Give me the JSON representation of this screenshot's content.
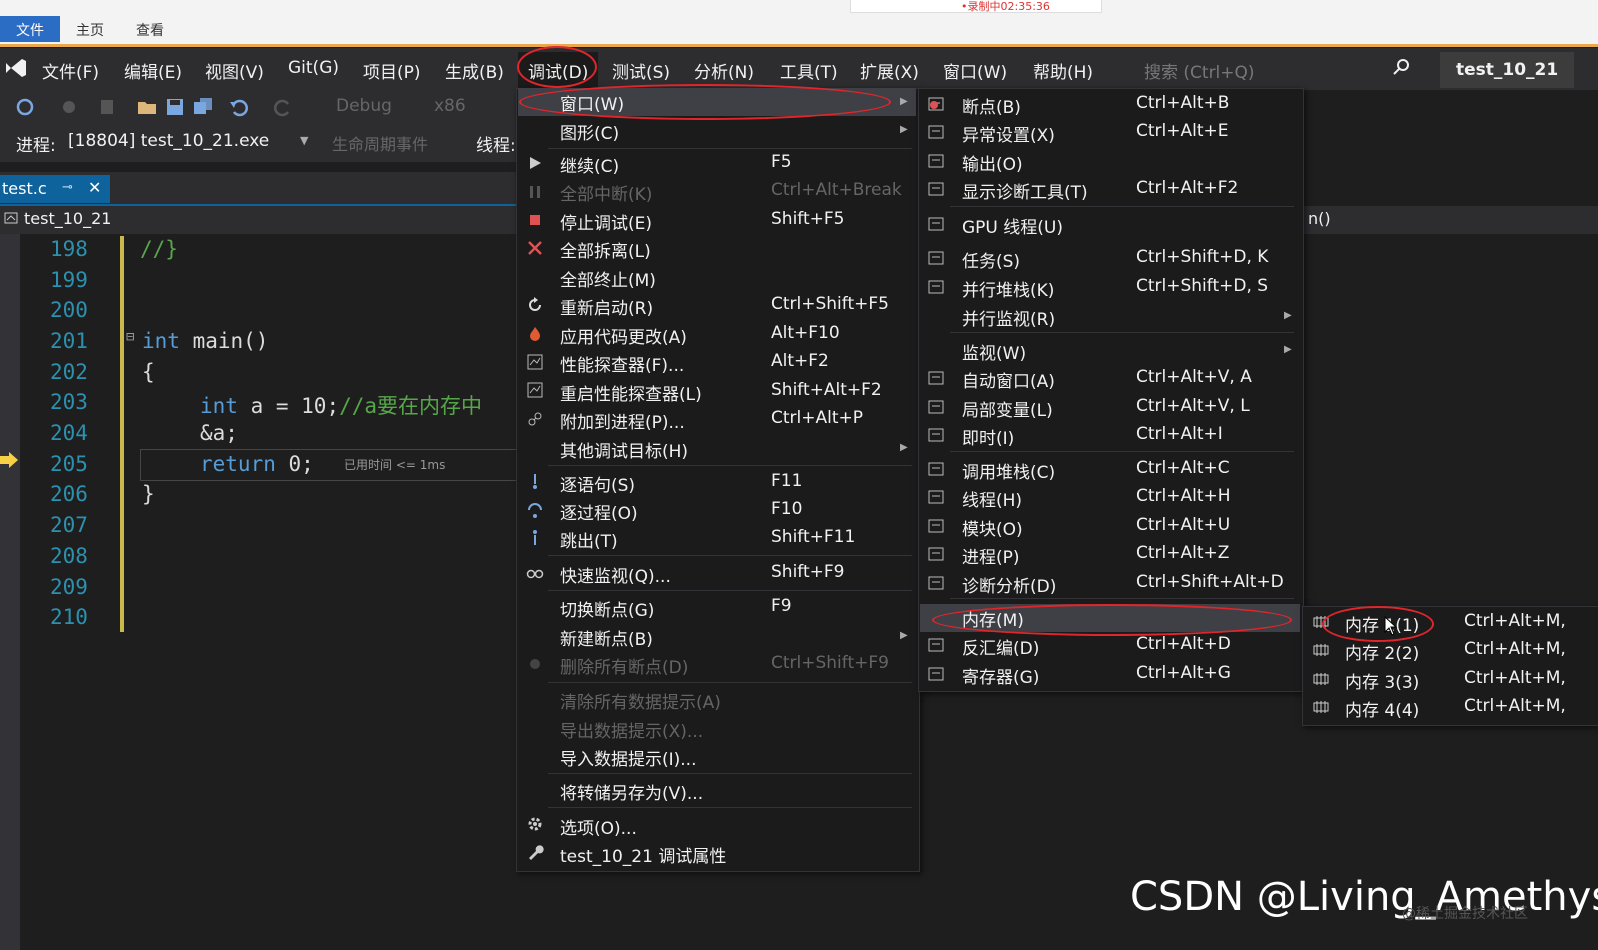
{
  "recorder": {
    "tabs": [
      "文件",
      "主页",
      "查看"
    ],
    "status": "•录制中02:35:36"
  },
  "menubar": {
    "items": [
      "文件(F)",
      "编辑(E)",
      "视图(V)",
      "Git(G)",
      "项目(P)",
      "生成(B)",
      "调试(D)",
      "测试(S)",
      "分析(N)",
      "工具(T)",
      "扩展(X)",
      "窗口(W)",
      "帮助(H)"
    ],
    "search_placeholder": "搜索 (Ctrl+Q)",
    "solution": "test_10_21"
  },
  "toolbar": {
    "config": "Debug",
    "platform": "x86"
  },
  "process": {
    "label": "进程:",
    "value": "[18804] test_10_21.exe",
    "lifecycle": "生命周期事件",
    "thread_label": "线程:"
  },
  "tab": {
    "name": "test.c",
    "pin": "⊸",
    "close": "✕"
  },
  "navbar": {
    "project": "test_10_21",
    "right": "n()"
  },
  "editor": {
    "lines": [
      "198",
      "199",
      "200",
      "201",
      "202",
      "203",
      "204",
      "205",
      "206",
      "207",
      "208",
      "209",
      "210"
    ],
    "code": {
      "l198": "//}",
      "l201_kw": "int",
      "l201_rest": " main()",
      "l202": "{",
      "l203_kw": "int",
      "l203_rest": " a = 10;",
      "l203_cm": "//a要在内存中",
      "l204": "&a;",
      "l205_kw": "return",
      "l205_rest": " 0;",
      "l206": "}"
    },
    "elapsed": "已用时间 <= 1ms"
  },
  "debug_menu": {
    "window": "窗口(W)",
    "graphics": "图形(C)",
    "continue": {
      "label": "继续(C)",
      "shortcut": "F5"
    },
    "break_all": {
      "label": "全部中断(K)",
      "shortcut": "Ctrl+Alt+Break"
    },
    "stop": {
      "label": "停止调试(E)",
      "shortcut": "Shift+F5"
    },
    "detach_all": {
      "label": "全部拆离(L)"
    },
    "terminate_all": {
      "label": "全部终止(M)"
    },
    "restart": {
      "label": "重新启动(R)",
      "shortcut": "Ctrl+Shift+F5"
    },
    "apply_code": {
      "label": "应用代码更改(A)",
      "shortcut": "Alt+F10"
    },
    "profiler": {
      "label": "性能探查器(F)...",
      "shortcut": "Alt+F2"
    },
    "relaunch_profiler": {
      "label": "重启性能探查器(L)",
      "shortcut": "Shift+Alt+F2"
    },
    "attach": {
      "label": "附加到进程(P)...",
      "shortcut": "Ctrl+Alt+P"
    },
    "other_targets": {
      "label": "其他调试目标(H)"
    },
    "step_into": {
      "label": "逐语句(S)",
      "shortcut": "F11"
    },
    "step_over": {
      "label": "逐过程(O)",
      "shortcut": "F10"
    },
    "step_out": {
      "label": "跳出(T)",
      "shortcut": "Shift+F11"
    },
    "quick_watch": {
      "label": "快速监视(Q)...",
      "shortcut": "Shift+F9"
    },
    "toggle_bp": {
      "label": "切换断点(G)",
      "shortcut": "F9"
    },
    "new_bp": {
      "label": "新建断点(B)"
    },
    "delete_bps": {
      "label": "删除所有断点(D)",
      "shortcut": "Ctrl+Shift+F9"
    },
    "clear_tips": {
      "label": "清除所有数据提示(A)"
    },
    "export_tips": {
      "label": "导出数据提示(X)..."
    },
    "import_tips": {
      "label": "导入数据提示(I)..."
    },
    "save_dump": {
      "label": "将转储另存为(V)..."
    },
    "options": {
      "label": "选项(O)..."
    },
    "props": {
      "label": "test_10_21 调试属性"
    }
  },
  "window_menu": {
    "items": [
      {
        "label": "断点(B)",
        "shortcut": "Ctrl+Alt+B"
      },
      {
        "label": "异常设置(X)",
        "shortcut": "Ctrl+Alt+E"
      },
      {
        "label": "输出(O)",
        "shortcut": ""
      },
      {
        "label": "显示诊断工具(T)",
        "shortcut": "Ctrl+Alt+F2"
      },
      {
        "label": "GPU 线程(U)",
        "shortcut": ""
      },
      {
        "label": "任务(S)",
        "shortcut": "Ctrl+Shift+D, K"
      },
      {
        "label": "并行堆栈(K)",
        "shortcut": "Ctrl+Shift+D, S"
      },
      {
        "label": "并行监视(R)",
        "shortcut": ""
      },
      {
        "label": "监视(W)",
        "shortcut": ""
      },
      {
        "label": "自动窗口(A)",
        "shortcut": "Ctrl+Alt+V, A"
      },
      {
        "label": "局部变量(L)",
        "shortcut": "Ctrl+Alt+V, L"
      },
      {
        "label": "即时(I)",
        "shortcut": "Ctrl+Alt+I"
      },
      {
        "label": "调用堆栈(C)",
        "shortcut": "Ctrl+Alt+C"
      },
      {
        "label": "线程(H)",
        "shortcut": "Ctrl+Alt+H"
      },
      {
        "label": "模块(O)",
        "shortcut": "Ctrl+Alt+U"
      },
      {
        "label": "进程(P)",
        "shortcut": "Ctrl+Alt+Z"
      },
      {
        "label": "诊断分析(D)",
        "shortcut": "Ctrl+Shift+Alt+D"
      },
      {
        "label": "内存(M)",
        "shortcut": ""
      },
      {
        "label": "反汇编(D)",
        "shortcut": "Ctrl+Alt+D"
      },
      {
        "label": "寄存器(G)",
        "shortcut": "Ctrl+Alt+G"
      }
    ]
  },
  "memory_menu": {
    "items": [
      {
        "label": "内存 1(1)",
        "shortcut": "Ctrl+Alt+M,"
      },
      {
        "label": "内存 2(2)",
        "shortcut": "Ctrl+Alt+M,"
      },
      {
        "label": "内存 3(3)",
        "shortcut": "Ctrl+Alt+M,"
      },
      {
        "label": "内存 4(4)",
        "shortcut": "Ctrl+Alt+M,"
      }
    ]
  },
  "watermark": {
    "main": "CSDN @Living_Amethyst",
    "sub": "@稀土掘金技术社区"
  },
  "colors": {
    "highlight_oval": "#e0262b",
    "accent": "#0e639c"
  }
}
